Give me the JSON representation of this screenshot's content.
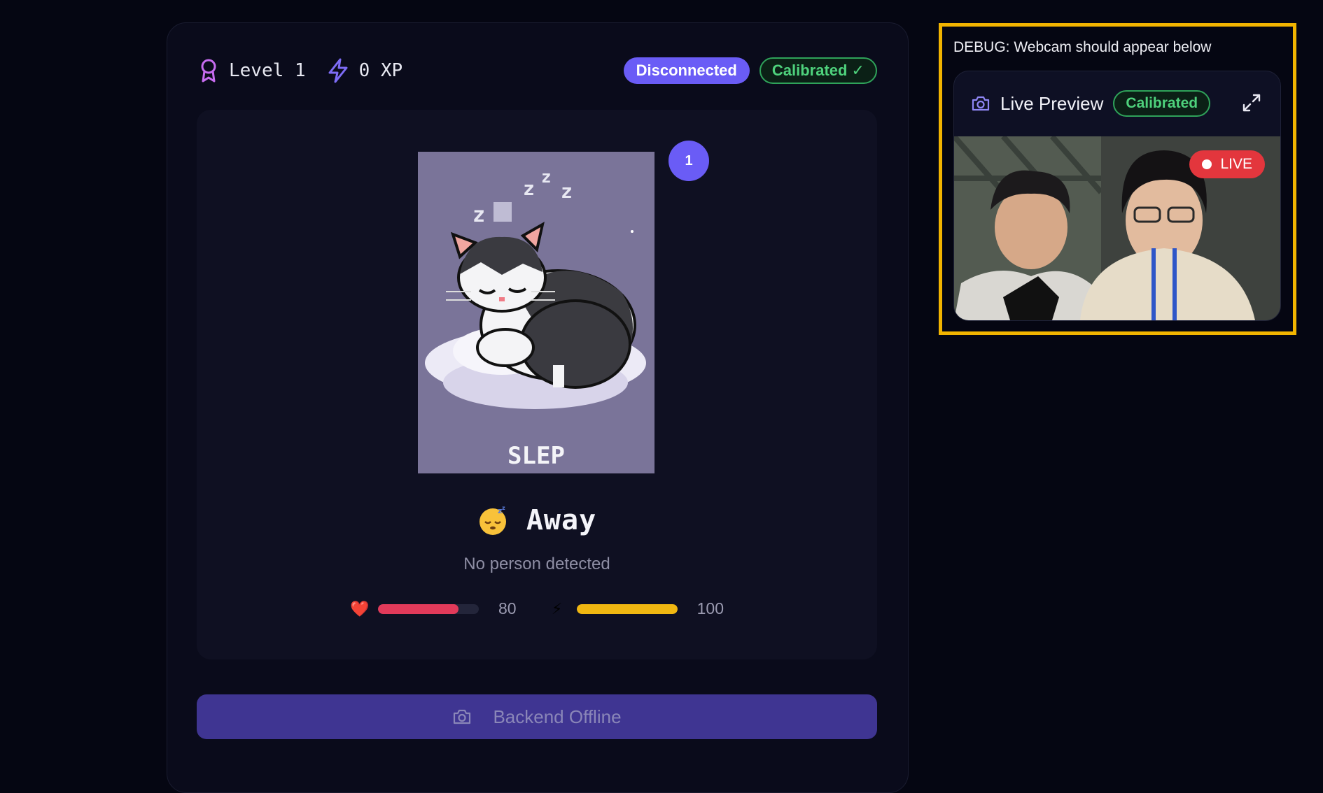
{
  "header": {
    "level_label": "Level 1",
    "xp_label": "0 XP",
    "connection_badge": "Disconnected",
    "calibration_badge": "Calibrated ✓"
  },
  "pet": {
    "notification_count": "1",
    "sprite_caption": "SLEP",
    "sprite_zzz": "zZz",
    "state_emoji": "sleeping-face",
    "state_title": "Away",
    "state_subtitle": "No person detected",
    "stats": [
      {
        "name": "health",
        "icon": "❤️",
        "value": 80,
        "max": 100,
        "value_label": "80",
        "color": "#e23a5a"
      },
      {
        "name": "energy",
        "icon": "⚡",
        "value": 100,
        "max": 100,
        "value_label": "100",
        "color": "#f0b711"
      }
    ]
  },
  "actions": {
    "backend_button": "Backend Offline"
  },
  "debug": {
    "label": "DEBUG: Webcam should appear below",
    "preview_title": "Live Preview",
    "preview_badge": "Calibrated",
    "live_label": "LIVE"
  },
  "colors": {
    "accent": "#6a5cf6",
    "success": "#4ed17c",
    "live": "#e3363d",
    "debug_border": "#f2b400"
  }
}
